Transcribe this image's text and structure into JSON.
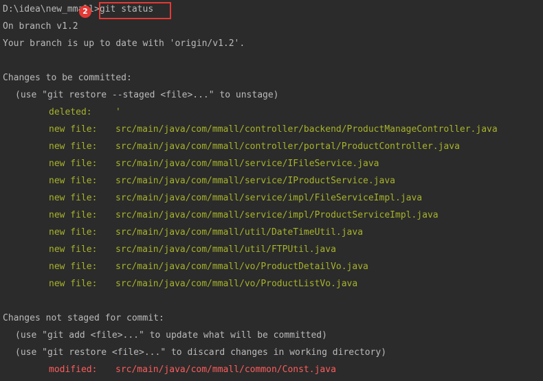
{
  "terminal": {
    "prompt_path": "D:\\idea\\new_mmall",
    "prompt_sep": ">",
    "command": "git status",
    "step_badge": "2",
    "branch_line": "On branch v1.2",
    "upstream_line": "Your branch is up to date with 'origin/v1.2'.",
    "staged_header": "Changes to be committed:",
    "staged_hint": "(use \"git restore --staged <file>...\" to unstage)",
    "staged_files": [
      {
        "status": "deleted:",
        "path": "'"
      },
      {
        "status": "new file:",
        "path": "src/main/java/com/mmall/controller/backend/ProductManageController.java"
      },
      {
        "status": "new file:",
        "path": "src/main/java/com/mmall/controller/portal/ProductController.java"
      },
      {
        "status": "new file:",
        "path": "src/main/java/com/mmall/service/IFileService.java"
      },
      {
        "status": "new file:",
        "path": "src/main/java/com/mmall/service/IProductService.java"
      },
      {
        "status": "new file:",
        "path": "src/main/java/com/mmall/service/impl/FileServiceImpl.java"
      },
      {
        "status": "new file:",
        "path": "src/main/java/com/mmall/service/impl/ProductServiceImpl.java"
      },
      {
        "status": "new file:",
        "path": "src/main/java/com/mmall/util/DateTimeUtil.java"
      },
      {
        "status": "new file:",
        "path": "src/main/java/com/mmall/util/FTPUtil.java"
      },
      {
        "status": "new file:",
        "path": "src/main/java/com/mmall/vo/ProductDetailVo.java"
      },
      {
        "status": "new file:",
        "path": "src/main/java/com/mmall/vo/ProductListVo.java"
      }
    ],
    "unstaged_header": "Changes not staged for commit:",
    "unstaged_hint_1": "(use \"git add <file>...\" to update what will be committed)",
    "unstaged_hint_2": "(use \"git restore <file>...\" to discard changes in working directory)",
    "unstaged_files": [
      {
        "status": "modified:",
        "path": "src/main/java/com/mmall/common/Const.java"
      }
    ],
    "colors": {
      "background": "#2b2b2b",
      "text": "#bbbbbb",
      "staged": "#a8b32a",
      "unstaged": "#ff5c5c",
      "annotation": "#e53935"
    }
  }
}
